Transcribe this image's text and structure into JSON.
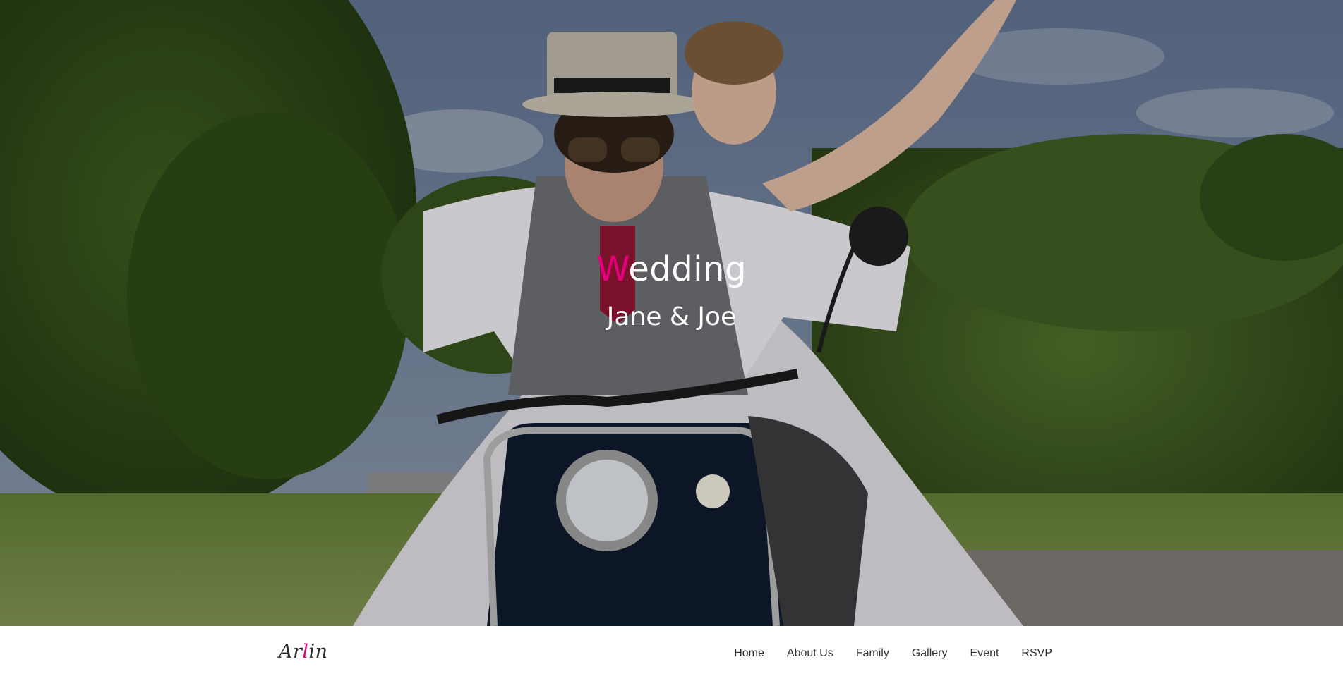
{
  "hero": {
    "title_initial": "W",
    "title_rest": "edding",
    "subtitle": "Jane & Joe",
    "background_image": "bride-and-groom-on-scooter-photo"
  },
  "navbar": {
    "brand_before": "Ar",
    "brand_accent": "l",
    "brand_after": "in",
    "items": [
      {
        "label": "Home"
      },
      {
        "label": "About Us"
      },
      {
        "label": "Family"
      },
      {
        "label": "Gallery"
      },
      {
        "label": "Event"
      },
      {
        "label": "RSVP"
      }
    ]
  },
  "colors": {
    "accent": "#e6007e",
    "nav_text": "#2f2f2f",
    "hero_text": "#ffffff"
  }
}
